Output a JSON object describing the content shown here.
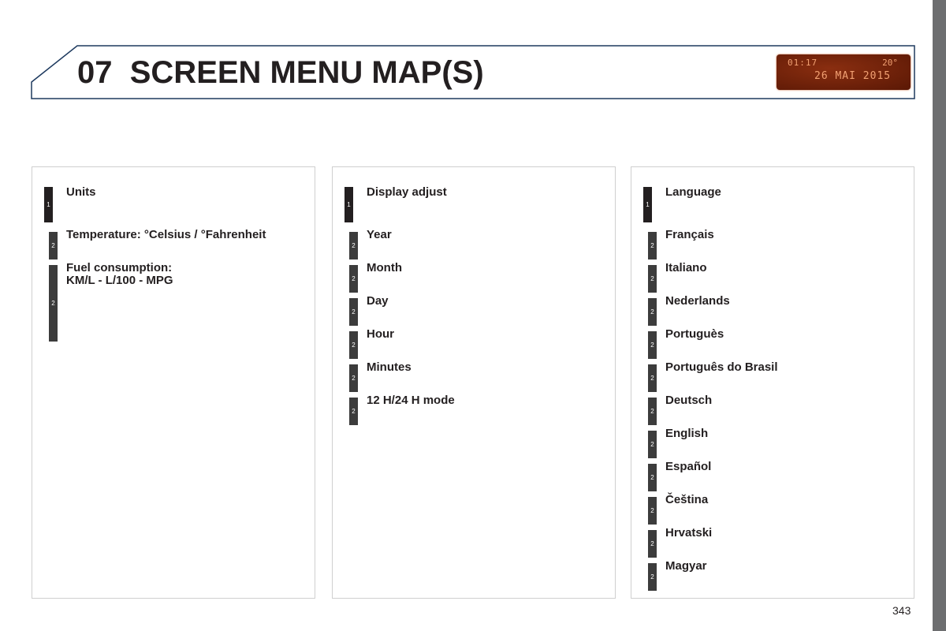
{
  "header": {
    "chapter": "07",
    "title": "SCREEN MENU MAP(S)"
  },
  "display": {
    "time": "01:17",
    "temperature": "20°",
    "date": "26 MAI 2015"
  },
  "panels": [
    {
      "items": [
        {
          "level": "1",
          "label": "Units"
        },
        {
          "level": "2",
          "label": "Temperature: °Celsius / °Fahrenheit"
        },
        {
          "level": "2",
          "label": "Fuel consumption:\nKM/L - L/100 - MPG"
        }
      ]
    },
    {
      "items": [
        {
          "level": "1",
          "label": "Display adjust"
        },
        {
          "level": "2",
          "label": "Year"
        },
        {
          "level": "2",
          "label": "Month"
        },
        {
          "level": "2",
          "label": "Day"
        },
        {
          "level": "2",
          "label": "Hour"
        },
        {
          "level": "2",
          "label": "Minutes"
        },
        {
          "level": "2",
          "label": "12 H/24 H mode"
        }
      ]
    },
    {
      "items": [
        {
          "level": "1",
          "label": "Language"
        },
        {
          "level": "2",
          "label": "Français"
        },
        {
          "level": "2",
          "label": "Italiano"
        },
        {
          "level": "2",
          "label": "Nederlands"
        },
        {
          "level": "2",
          "label": "Portuguès"
        },
        {
          "level": "2",
          "label": "Português do Brasil"
        },
        {
          "level": "2",
          "label": "Deutsch"
        },
        {
          "level": "2",
          "label": "English"
        },
        {
          "level": "2",
          "label": "Español"
        },
        {
          "level": "2",
          "label": "Čeština"
        },
        {
          "level": "2",
          "label": "Hrvatski"
        },
        {
          "level": "2",
          "label": "Magyar"
        }
      ]
    }
  ],
  "page_number": "343"
}
